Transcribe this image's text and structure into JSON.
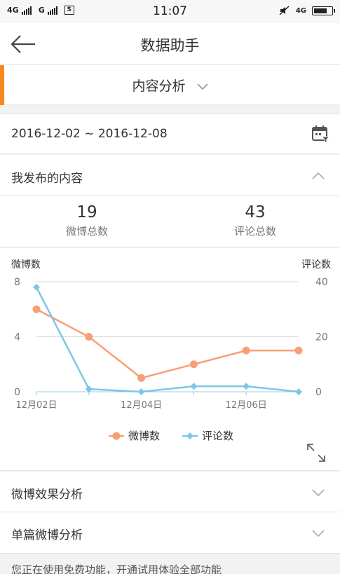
{
  "status_bar": {
    "net1": "4G",
    "net2": "G",
    "sim_label": "S",
    "time": "11:07",
    "net_right": "4G"
  },
  "header": {
    "title": "数据助手"
  },
  "tab": {
    "label": "内容分析"
  },
  "date_range": "2016-12-02 ~ 2016-12-08",
  "sections": {
    "my_content": "我发布的内容",
    "weibo_effect": "微博效果分析",
    "single_weibo": "单篇微博分析"
  },
  "stats": [
    {
      "value": "19",
      "label": "微博总数"
    },
    {
      "value": "43",
      "label": "评论总数"
    }
  ],
  "chart_data": {
    "type": "line",
    "categories": [
      "12月02日",
      "12月03日",
      "12月04日",
      "12月05日",
      "12月06日",
      "12月07日"
    ],
    "x_tick_labels": [
      "12月02日",
      "12月04日",
      "12月06日"
    ],
    "left_axis": {
      "label": "微博数",
      "ticks": [
        0,
        4,
        8
      ],
      "ylim": [
        0,
        8
      ]
    },
    "right_axis": {
      "label": "评论数",
      "ticks": [
        0,
        20,
        40
      ],
      "ylim": [
        0,
        40
      ]
    },
    "series": [
      {
        "name": "微博数",
        "axis": "left",
        "color": "#f89f75",
        "marker": "circle",
        "values": [
          6,
          4,
          1,
          2,
          3,
          3
        ]
      },
      {
        "name": "评论数",
        "axis": "right",
        "color": "#7ec6e6",
        "marker": "diamond",
        "values": [
          38,
          1,
          0,
          2,
          2,
          0
        ]
      }
    ],
    "grid": true,
    "legend": "bottom-center"
  },
  "notice": "您正在使用免费功能，开通试用体验全部功能"
}
